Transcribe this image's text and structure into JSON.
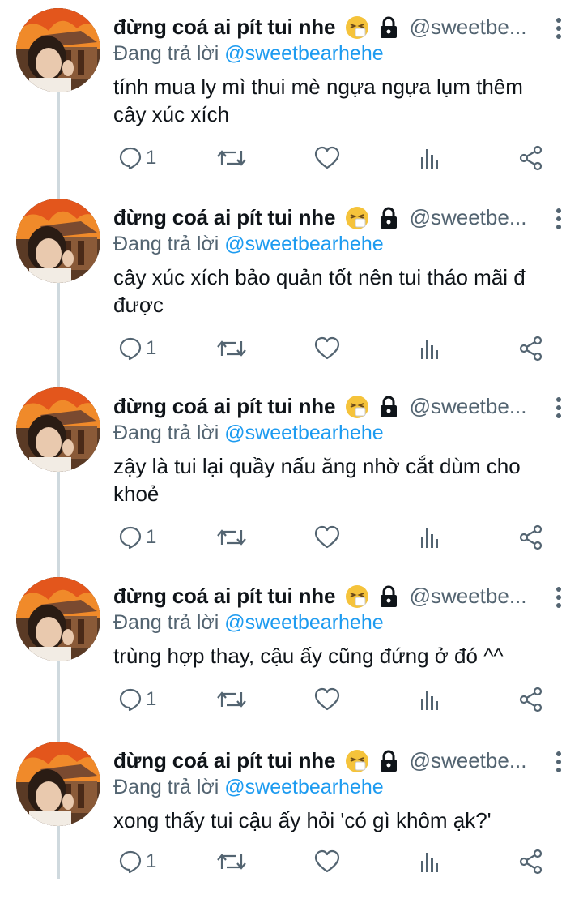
{
  "colors": {
    "text": "#0f1419",
    "secondary": "#536471",
    "link": "#1d9bf0",
    "thread_line": "#cfd9de"
  },
  "tweets": [
    {
      "display_name": "đừng coá ai pít tui nhe",
      "emoji": "sneezing-face-emoji",
      "handle": "@sweetbe...",
      "reply_prefix": "Đang trả lời",
      "reply_mention": "@sweetbearhehe",
      "text": "tính mua ly mì thui mè ngựa ngựa lụm thêm cây xúc xích",
      "replies": "1"
    },
    {
      "display_name": "đừng coá ai pít tui nhe",
      "emoji": "sneezing-face-emoji",
      "handle": "@sweetbe...",
      "reply_prefix": "Đang trả lời",
      "reply_mention": "@sweetbearhehe",
      "text": "cây xúc xích bảo quản tốt nên tui tháo mãi đ được",
      "replies": "1"
    },
    {
      "display_name": "đừng coá ai pít tui nhe",
      "emoji": "sneezing-face-emoji",
      "handle": "@sweetbe...",
      "reply_prefix": "Đang trả lời",
      "reply_mention": "@sweetbearhehe",
      "text": "zậy là tui lại quầy nấu ăng nhờ cắt dùm cho khoẻ",
      "replies": "1"
    },
    {
      "display_name": "đừng coá ai pít tui nhe",
      "emoji": "sneezing-face-emoji",
      "handle": "@sweetbe...",
      "reply_prefix": "Đang trả lời",
      "reply_mention": "@sweetbearhehe",
      "text": "trùng hợp thay, cậu ấy cũng đứng ở đó ^^",
      "replies": "1"
    },
    {
      "display_name": "đừng coá ai pít tui nhe",
      "emoji": "sneezing-face-emoji",
      "handle": "@sweetbe...",
      "reply_prefix": "Đang trả lời",
      "reply_mention": "@sweetbearhehe",
      "text": "xong thấy tui cậu ấy hỏi 'có gì khôm ạk?'",
      "replies": "1"
    }
  ]
}
